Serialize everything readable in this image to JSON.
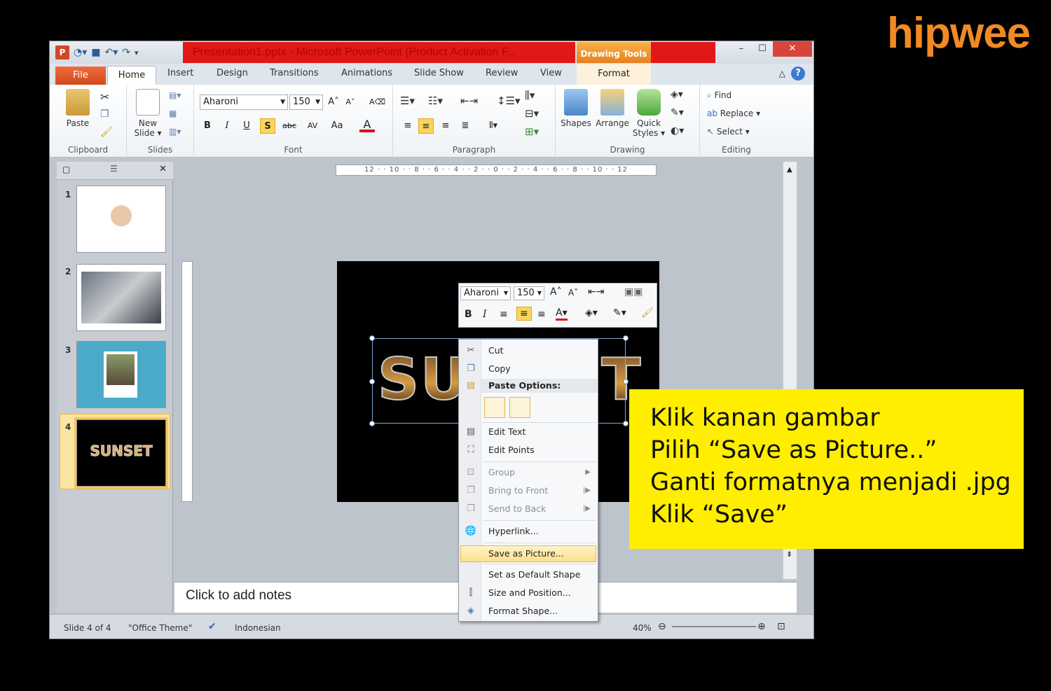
{
  "brand": {
    "logo_text": "hipwee",
    "logo_color": "#f08a24"
  },
  "window": {
    "title": "Presentation1.pptx - Microsoft PowerPoint (Product Activation F...",
    "contextual_tab_group": "Drawing Tools",
    "title_highlight_color": "#e11818",
    "min_label": "–",
    "max_label": "☐",
    "close_label": "✕"
  },
  "tabs": {
    "file": "File",
    "home": "Home",
    "insert": "Insert",
    "design": "Design",
    "transitions": "Transitions",
    "animations": "Animations",
    "slideshow": "Slide Show",
    "review": "Review",
    "view": "View",
    "format": "Format"
  },
  "ribbon": {
    "clipboard": {
      "label": "Clipboard",
      "paste": "Paste"
    },
    "slides": {
      "label": "Slides",
      "new_slide_1": "New",
      "new_slide_2": "Slide ▾"
    },
    "font": {
      "label": "Font",
      "name": "Aharoni",
      "size": "150",
      "bold": "B",
      "italic": "I",
      "underline": "U",
      "shadow": "S",
      "strike": "abc",
      "spacing": "AV",
      "case": "Aa",
      "color": "A"
    },
    "paragraph": {
      "label": "Paragraph"
    },
    "drawing": {
      "label": "Drawing",
      "shapes": "Shapes",
      "arrange": "Arrange",
      "quick_1": "Quick",
      "quick_2": "Styles ▾"
    },
    "editing": {
      "label": "Editing",
      "find": "Find",
      "replace": "Replace ▾",
      "select": "Select ▾"
    }
  },
  "slides_pane": {
    "thumbnails": [
      {
        "num": "1"
      },
      {
        "num": "2"
      },
      {
        "num": "3"
      },
      {
        "num": "4",
        "text": "SUNSET"
      }
    ]
  },
  "canvas": {
    "ruler_h": "12 · · 10 · · 8 · · 6 · · 4 · · 2 · · 0 · · 2 · · 4 · · 6 · · 8 · · 10 · · 12",
    "slide_text": "SUNSET"
  },
  "minibar": {
    "font": "Aharoni",
    "size": "150"
  },
  "context_menu": {
    "cut": "Cut",
    "copy": "Copy",
    "paste_options": "Paste Options:",
    "edit_text": "Edit Text",
    "edit_points": "Edit Points",
    "group": "Group",
    "bring_front": "Bring to Front",
    "send_back": "Send to Back",
    "hyperlink": "Hyperlink...",
    "save_picture": "Save as Picture...",
    "set_default": "Set as Default Shape",
    "size_position": "Size and Position...",
    "format_shape": "Format Shape..."
  },
  "notes": {
    "placeholder": "Click to add notes"
  },
  "status": {
    "slide": "Slide 4 of 4",
    "theme": "\"Office Theme\"",
    "language": "Indonesian",
    "zoom": "40%"
  },
  "callout": {
    "line1": "Klik kanan gambar",
    "line2": "Pilih “Save as Picture..”",
    "line3": "Ganti formatnya menjadi .jpg",
    "line4": "Klik “Save”",
    "bg_color": "#ffee00"
  }
}
